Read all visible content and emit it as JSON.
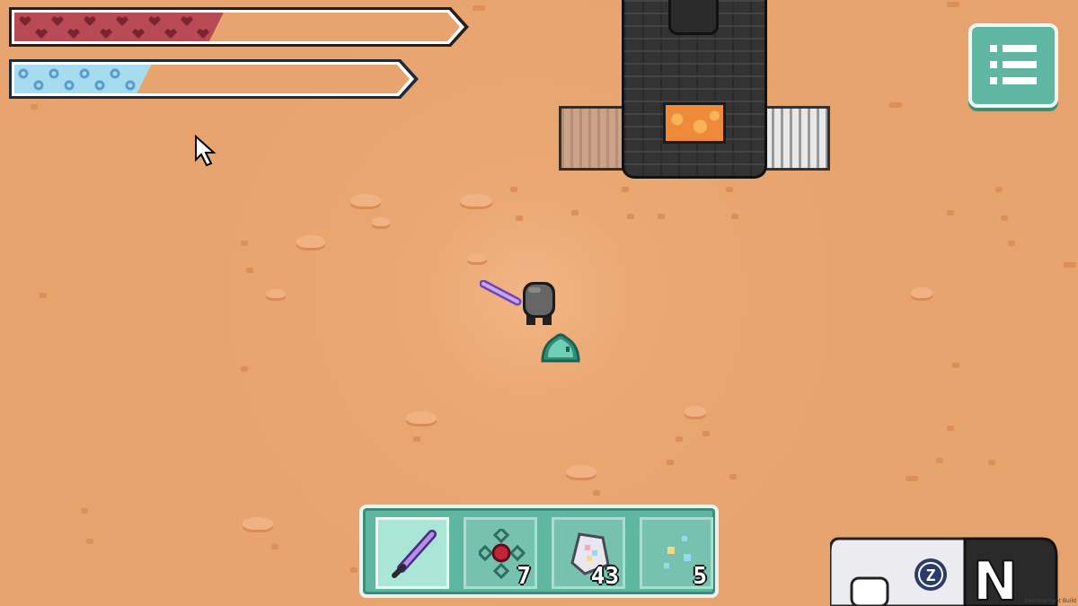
{
  "health": {
    "fill": 0.45,
    "color": "#b84a55",
    "bg": "#e8a46f"
  },
  "mana": {
    "fill": 0.32,
    "color": "#a6dcee",
    "bg": "#e8a46f"
  },
  "menu": {
    "icon": "list-menu-icon"
  },
  "hotbar": {
    "slots": [
      {
        "name": "purple-sword",
        "icon": "sword-icon",
        "count": "",
        "selected": true
      },
      {
        "name": "red-gem-compass",
        "icon": "gem-icon",
        "count": "7",
        "selected": false
      },
      {
        "name": "crystal-block",
        "icon": "crystal-block-icon",
        "count": "43",
        "selected": false
      },
      {
        "name": "sparkle-dust",
        "icon": "sparkle-icon",
        "count": "5",
        "selected": false
      }
    ]
  },
  "controller": {
    "z_label": "Z",
    "n_label": "N"
  },
  "dev_build": "Development Build"
}
